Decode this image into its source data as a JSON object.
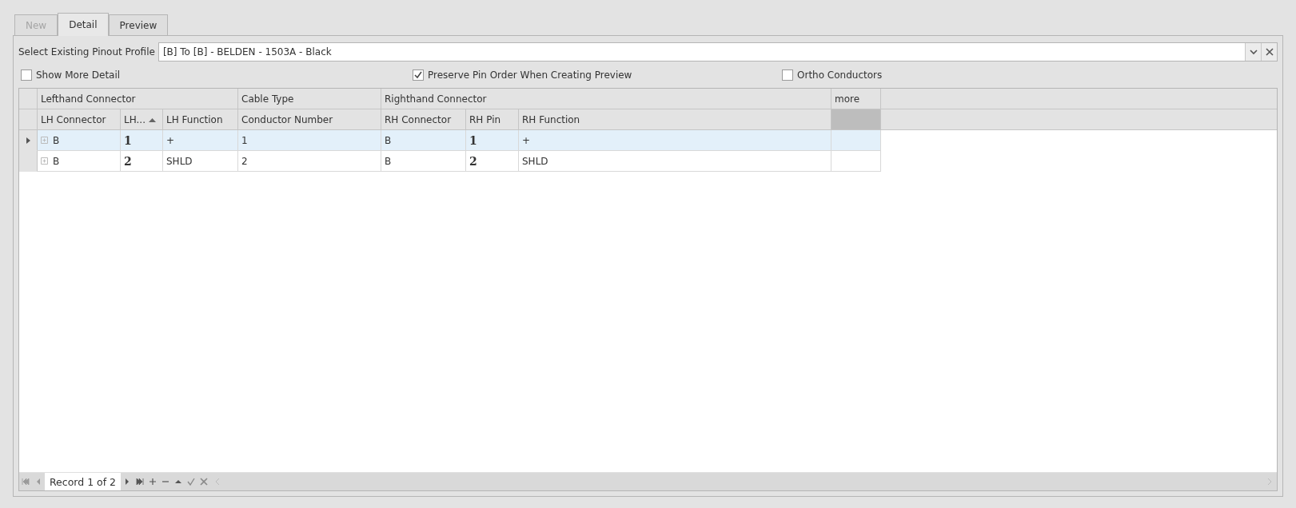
{
  "tabs": [
    {
      "label": "New",
      "selected": false,
      "disabled": true
    },
    {
      "label": "Detail",
      "selected": true,
      "disabled": false
    },
    {
      "label": "Preview",
      "selected": false,
      "disabled": false
    }
  ],
  "profile": {
    "label": "Select Existing Pinout Profile",
    "value": "[B] To [B] - BELDEN - 1503A - Black"
  },
  "options": [
    {
      "label": "Show More Detail",
      "checked": false
    },
    {
      "label": "Preserve Pin Order When Creating Preview",
      "checked": true
    },
    {
      "label": "Ortho Conductors",
      "checked": false
    }
  ],
  "grid": {
    "bands": [
      {
        "label": "Lefthand Connector",
        "columns": [
          {
            "label": "LH Connector",
            "kind": "expand",
            "sorted": false
          },
          {
            "label": "LH...",
            "kind": "pin",
            "sorted": true
          },
          {
            "label": "LH Function",
            "kind": "text",
            "sorted": false
          }
        ]
      },
      {
        "label": "Cable Type",
        "columns": [
          {
            "label": "Conductor Number",
            "kind": "text",
            "sorted": false
          }
        ]
      },
      {
        "label": "Righthand Connector",
        "columns": [
          {
            "label": "RH Connector",
            "kind": "text",
            "sorted": false
          },
          {
            "label": "RH Pin",
            "kind": "pin",
            "sorted": false
          },
          {
            "label": "RH Function",
            "kind": "text",
            "sorted": false
          }
        ]
      },
      {
        "label": "more",
        "columns": [
          {
            "kind": "blank"
          }
        ]
      }
    ],
    "rows": [
      {
        "selected": true,
        "cells": [
          "B",
          "1",
          "+",
          "1",
          "B",
          "1",
          "+"
        ]
      },
      {
        "selected": false,
        "cells": [
          "B",
          "2",
          "SHLD",
          "2",
          "B",
          "2",
          "SHLD"
        ]
      }
    ]
  },
  "navigator": {
    "text": "Record 1 of 2"
  }
}
